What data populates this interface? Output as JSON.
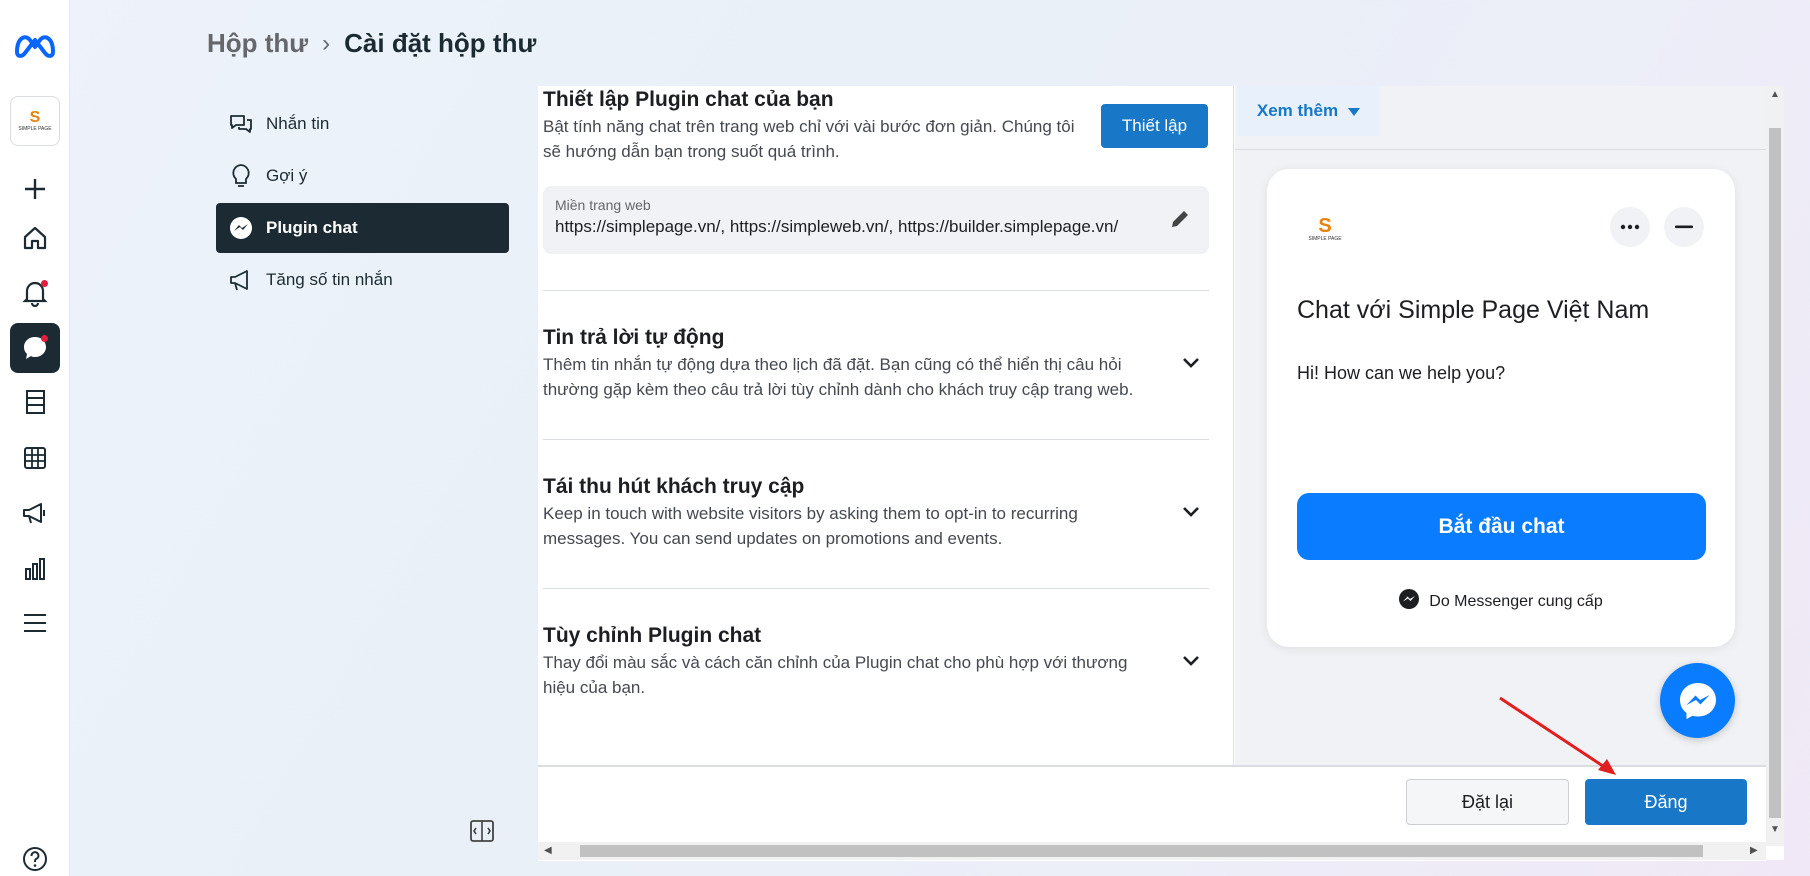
{
  "breadcrumb": {
    "parent": "Hộp thư",
    "current": "Cài đặt hộp thư"
  },
  "rail": {
    "brand_icon": "meta-logo-icon",
    "page_avatar_text": "S",
    "page_avatar_sub": "SIMPLE PAGE",
    "icons": [
      "plus-icon",
      "home-icon",
      "bell-icon",
      "chat-bubble-icon",
      "pages-icon",
      "table-icon",
      "megaphone-icon",
      "bar-chart-icon",
      "menu-icon",
      "help-icon"
    ]
  },
  "subnav": {
    "items": [
      {
        "label": "Nhắn tin",
        "icon": "chat-bubbles-icon"
      },
      {
        "label": "Gợi ý",
        "icon": "lightbulb-icon"
      },
      {
        "label": "Plugin chat",
        "icon": "messenger-icon"
      },
      {
        "label": "Tăng số tin nhắn",
        "icon": "megaphone-icon"
      }
    ],
    "active": "Plugin chat"
  },
  "sections": {
    "setup": {
      "title": "Thiết lập Plugin chat của bạn",
      "desc": "Bật tính năng chat trên trang web chỉ với vài bước đơn giản. Chúng tôi sẽ hướng dẫn bạn trong suốt quá trình.",
      "button": "Thiết lập",
      "domain_label": "Miền trang web",
      "domain_value": "https://simplepage.vn/, https://simpleweb.vn/, https://builder.simplepage.vn/"
    },
    "auto_reply": {
      "title": "Tin trả lời tự động",
      "desc": "Thêm tin nhắn tự động dựa theo lịch đã đặt. Bạn cũng có thể hiển thị câu hỏi thường gặp kèm theo câu trả lời tùy chỉnh dành cho khách truy cập trang web."
    },
    "reengage": {
      "title": "Tái thu hút khách truy cập",
      "desc": "Keep in touch with website visitors by asking them to opt-in to recurring messages. You can send updates on promotions and events."
    },
    "customize": {
      "title": "Tùy chỉnh Plugin chat",
      "desc": "Thay đổi màu sắc và cách căn chỉnh của Plugin chat cho phù hợp với thương hiệu của bạn."
    }
  },
  "preview": {
    "see_more": "Xem thêm",
    "logo_text": "S",
    "logo_sub": "SIMPLE PAGE",
    "title": "Chat với Simple Page Việt Nam",
    "greeting": "Hi! How can we help you?",
    "start_button": "Bắt đầu chat",
    "powered_by": "Do Messenger cung cấp"
  },
  "footer": {
    "reset": "Đặt lại",
    "post": "Đăng"
  },
  "colors": {
    "primary": "#1877c6",
    "messenger_blue": "#0a7cff",
    "dark": "#1c2b33",
    "annotation_arrow": "#e02020"
  }
}
